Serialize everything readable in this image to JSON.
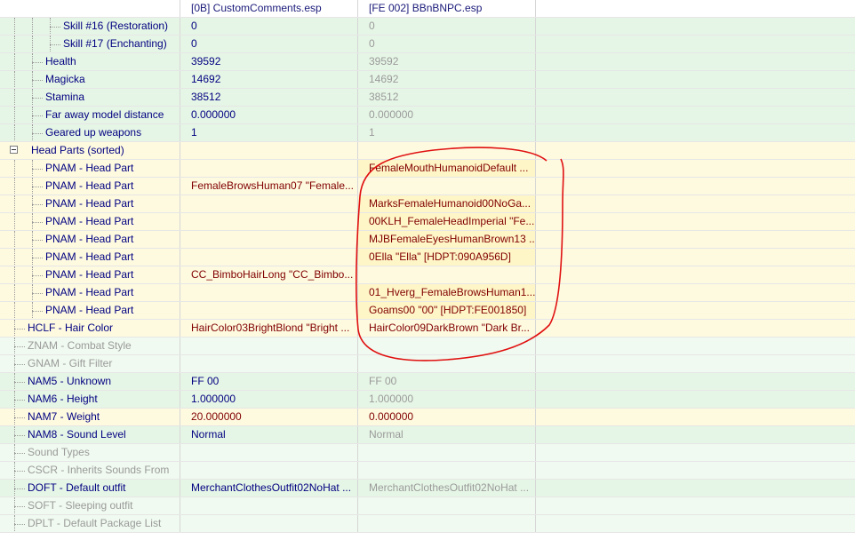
{
  "columns": {
    "name": "",
    "col1": "[0B] CustomComments.esp",
    "col2": "[FE 002] BBnBNPC.esp"
  },
  "rows": [
    {
      "label": "Skill #16 (Restoration)",
      "v1": "0",
      "v2": "0",
      "theme": "g",
      "depth": 3
    },
    {
      "label": "Skill #17 (Enchanting)",
      "v1": "0",
      "v2": "0",
      "theme": "g",
      "depth": 3
    },
    {
      "label": "Health",
      "v1": "39592",
      "v2": "39592",
      "theme": "g",
      "depth": 2
    },
    {
      "label": "Magicka",
      "v1": "14692",
      "v2": "14692",
      "theme": "g",
      "depth": 2
    },
    {
      "label": "Stamina",
      "v1": "38512",
      "v2": "38512",
      "theme": "g",
      "depth": 2
    },
    {
      "label": "Far away model distance",
      "v1": "0.000000",
      "v2": "0.000000",
      "theme": "g",
      "depth": 2
    },
    {
      "label": "Geared up weapons",
      "v1": "1",
      "v2": "1",
      "theme": "g",
      "depth": 2
    },
    {
      "label": "Head Parts (sorted)",
      "v1": "",
      "v2": "",
      "theme": "y",
      "depth": 1,
      "expander": true
    },
    {
      "label": "PNAM - Head Part",
      "v1": "",
      "v2": "FemaleMouthHumanoidDefault ...",
      "theme": "y",
      "depth": 2
    },
    {
      "label": "PNAM - Head Part",
      "v1": "FemaleBrowsHuman07 \"Female...",
      "v2": "",
      "theme": "y",
      "depth": 2
    },
    {
      "label": "PNAM - Head Part",
      "v1": "",
      "v2": "MarksFemaleHumanoid00NoGa...",
      "theme": "y",
      "depth": 2
    },
    {
      "label": "PNAM - Head Part",
      "v1": "",
      "v2": "00KLH_FemaleHeadImperial \"Fe...",
      "theme": "y",
      "depth": 2
    },
    {
      "label": "PNAM - Head Part",
      "v1": "",
      "v2": "MJBFemaleEyesHumanBrown13 ...",
      "theme": "y",
      "depth": 2
    },
    {
      "label": "PNAM - Head Part",
      "v1": "",
      "v2": "0Ella \"Ella\" [HDPT:090A956D]",
      "theme": "y",
      "depth": 2
    },
    {
      "label": "PNAM - Head Part",
      "v1": "CC_BimboHairLong \"CC_Bimbo...",
      "v2": "",
      "theme": "y",
      "depth": 2
    },
    {
      "label": "PNAM - Head Part",
      "v1": "",
      "v2": "01_Hverg_FemaleBrowsHuman1...",
      "theme": "y",
      "depth": 2
    },
    {
      "label": "PNAM - Head Part",
      "v1": "",
      "v2": "Goams00 \"00\" [HDPT:FE001850]",
      "theme": "y",
      "depth": 2
    },
    {
      "label": "HCLF - Hair Color",
      "v1": "HairColor03BrightBlond \"Bright ...",
      "v2": "HairColor09DarkBrown \"Dark Br...",
      "theme": "yc",
      "depth": 1
    },
    {
      "label": "ZNAM - Combat Style",
      "v1": "",
      "v2": "",
      "theme": "p",
      "depth": 1
    },
    {
      "label": "GNAM - Gift Filter",
      "v1": "",
      "v2": "",
      "theme": "p",
      "depth": 1
    },
    {
      "label": "NAM5 - Unknown",
      "v1": "FF 00",
      "v2": "FF 00",
      "theme": "g",
      "depth": 1
    },
    {
      "label": "NAM6 - Height",
      "v1": "1.000000",
      "v2": "1.000000",
      "theme": "g",
      "depth": 1
    },
    {
      "label": "NAM7 - Weight",
      "v1": "20.000000",
      "v2": "0.000000",
      "theme": "yc",
      "depth": 1
    },
    {
      "label": "NAM8 - Sound Level",
      "v1": "Normal",
      "v2": "Normal",
      "theme": "g",
      "depth": 1
    },
    {
      "label": "Sound Types",
      "v1": "",
      "v2": "",
      "theme": "p",
      "depth": 1
    },
    {
      "label": "CSCR - Inherits Sounds From",
      "v1": "",
      "v2": "",
      "theme": "p",
      "depth": 1
    },
    {
      "label": "DOFT - Default outfit",
      "v1": "MerchantClothesOutfit02NoHat ...",
      "v2": "MerchantClothesOutfit02NoHat ...",
      "theme": "g",
      "depth": 1
    },
    {
      "label": "SOFT - Sleeping outfit",
      "v1": "",
      "v2": "",
      "theme": "p",
      "depth": 1
    },
    {
      "label": "DPLT - Default Package List",
      "v1": "",
      "v2": "",
      "theme": "p",
      "depth": 1
    }
  ],
  "annotation": {
    "color": "#e01010"
  }
}
